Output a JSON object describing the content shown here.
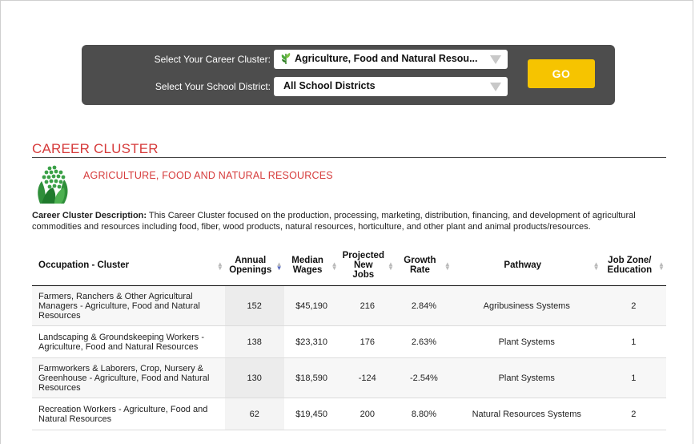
{
  "selector": {
    "career_label": "Select Your Career Cluster:",
    "district_label": "Select Your School District:",
    "career_value": "Agriculture, Food and Natural Resou...",
    "district_value": "All School Districts",
    "go_label": "GO",
    "leaf_icon": "leaf-icon",
    "button_color": "#f6c400"
  },
  "section": {
    "heading": "CAREER CLUSTER",
    "cluster_name": "AGRICULTURE, FOOD AND NATURAL RESOURCES",
    "cluster_icon": "corn-icon",
    "accent_color": "#d63b3b",
    "desc_label": "Career Cluster Description:",
    "desc_text": " This Career Cluster focused on the production, processing, marketing, distribution, financing, and development of agricultural commodities and resources including food, fiber, wood products, natural resources, horticulture, and other plant and animal products/resources."
  },
  "table": {
    "columns": [
      {
        "label": "Occupation - Cluster"
      },
      {
        "label": "Annual Openings"
      },
      {
        "label": "Median Wages"
      },
      {
        "label": "Projected New Jobs"
      },
      {
        "label": "Growth Rate"
      },
      {
        "label": "Pathway"
      },
      {
        "label": "Job Zone/ Education"
      }
    ],
    "rows": [
      {
        "occupation": "Farmers, Ranchers & Other Agricultural Managers - Agriculture, Food and Natural Resources",
        "openings": "152",
        "wages": "$45,190",
        "new_jobs": "216",
        "growth": "2.84%",
        "pathway": "Agribusiness Systems",
        "zone": "2"
      },
      {
        "occupation": "Landscaping & Groundskeeping Workers - Agriculture, Food and Natural Resources",
        "openings": "138",
        "wages": "$23,310",
        "new_jobs": "176",
        "growth": "2.63%",
        "pathway": "Plant Systems",
        "zone": "1"
      },
      {
        "occupation": "Farmworkers & Laborers, Crop, Nursery & Greenhouse - Agriculture, Food and Natural Resources",
        "openings": "130",
        "wages": "$18,590",
        "new_jobs": "-124",
        "growth": "-2.54%",
        "pathway": "Plant Systems",
        "zone": "1"
      },
      {
        "occupation": "Recreation Workers - Agriculture, Food and Natural Resources",
        "openings": "62",
        "wages": "$19,450",
        "new_jobs": "200",
        "growth": "8.80%",
        "pathway": "Natural Resources Systems",
        "zone": "2"
      }
    ]
  }
}
